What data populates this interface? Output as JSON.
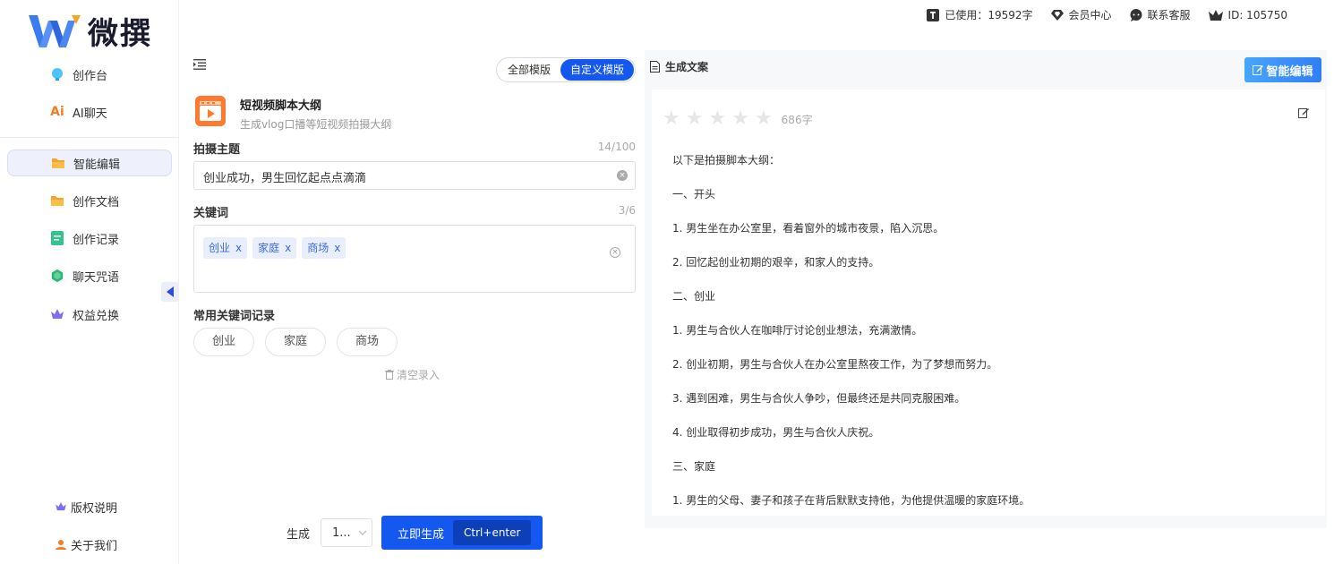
{
  "brand": {
    "name": "微撰"
  },
  "topbar": {
    "usage": "已使用：19592字",
    "member": "会员中心",
    "service": "联系客服",
    "id": "ID: 105750"
  },
  "sidebar": {
    "items": [
      {
        "label": "创作台",
        "icon": "bulb-icon"
      },
      {
        "label": "AI聊天",
        "icon": "ai-icon"
      },
      {
        "label": "智能编辑",
        "icon": "folder-icon",
        "active": true
      },
      {
        "label": "创作文档",
        "icon": "folder-icon"
      },
      {
        "label": "创作记录",
        "icon": "record-icon"
      },
      {
        "label": "聊天咒语",
        "icon": "gem-icon"
      },
      {
        "label": "权益兑换",
        "icon": "crown-icon"
      }
    ],
    "bottom": [
      {
        "label": "版权说明",
        "icon": "crown-icon"
      },
      {
        "label": "关于我们",
        "icon": "user-icon"
      }
    ]
  },
  "templates": {
    "all": "全部模版",
    "custom": "自定义模版"
  },
  "tool": {
    "title": "短视频脚本大纲",
    "desc": "生成vlog口播等短视频拍摄大纲"
  },
  "form": {
    "topic_label": "拍摄主题",
    "topic_count": "14/100",
    "topic_value": "创业成功，男生回忆起点点滴滴",
    "keywords_label": "关键词",
    "keywords_count": "3/6",
    "keywords": [
      "创业",
      "家庭",
      "商场"
    ],
    "tag_close": "x",
    "history_label": "常用关键词记录",
    "history": [
      "创业",
      "家庭",
      "商场"
    ],
    "clear_history": "清空录入"
  },
  "generate": {
    "label": "生成",
    "count": "1...",
    "button": "立即生成",
    "shortcut": "Ctrl+enter"
  },
  "output": {
    "title": "生成文案",
    "smart_edit": "智能编辑",
    "word_count": "686字",
    "rating": 0,
    "lines": [
      "以下是拍摄脚本大纲：",
      "一、开头",
      "1. 男生坐在办公室里，看着窗外的城市夜景，陷入沉思。",
      "2. 回忆起创业初期的艰辛，和家人的支持。",
      "二、创业",
      "1. 男生与合伙人在咖啡厅讨论创业想法，充满激情。",
      "2. 创业初期，男生与合伙人在办公室里熬夜工作，为了梦想而努力。",
      "3. 遇到困难，男生与合伙人争吵，但最终还是共同克服困难。",
      "4. 创业取得初步成功，男生与合伙人庆祝。",
      "三、家庭",
      "1. 男生的父母、妻子和孩子在背后默默支持他，为他提供温暖的家庭环境。"
    ]
  },
  "colors": {
    "primary": "#1558f0",
    "accent": "#2f7ef6",
    "tag_bg": "#e8eefc"
  }
}
